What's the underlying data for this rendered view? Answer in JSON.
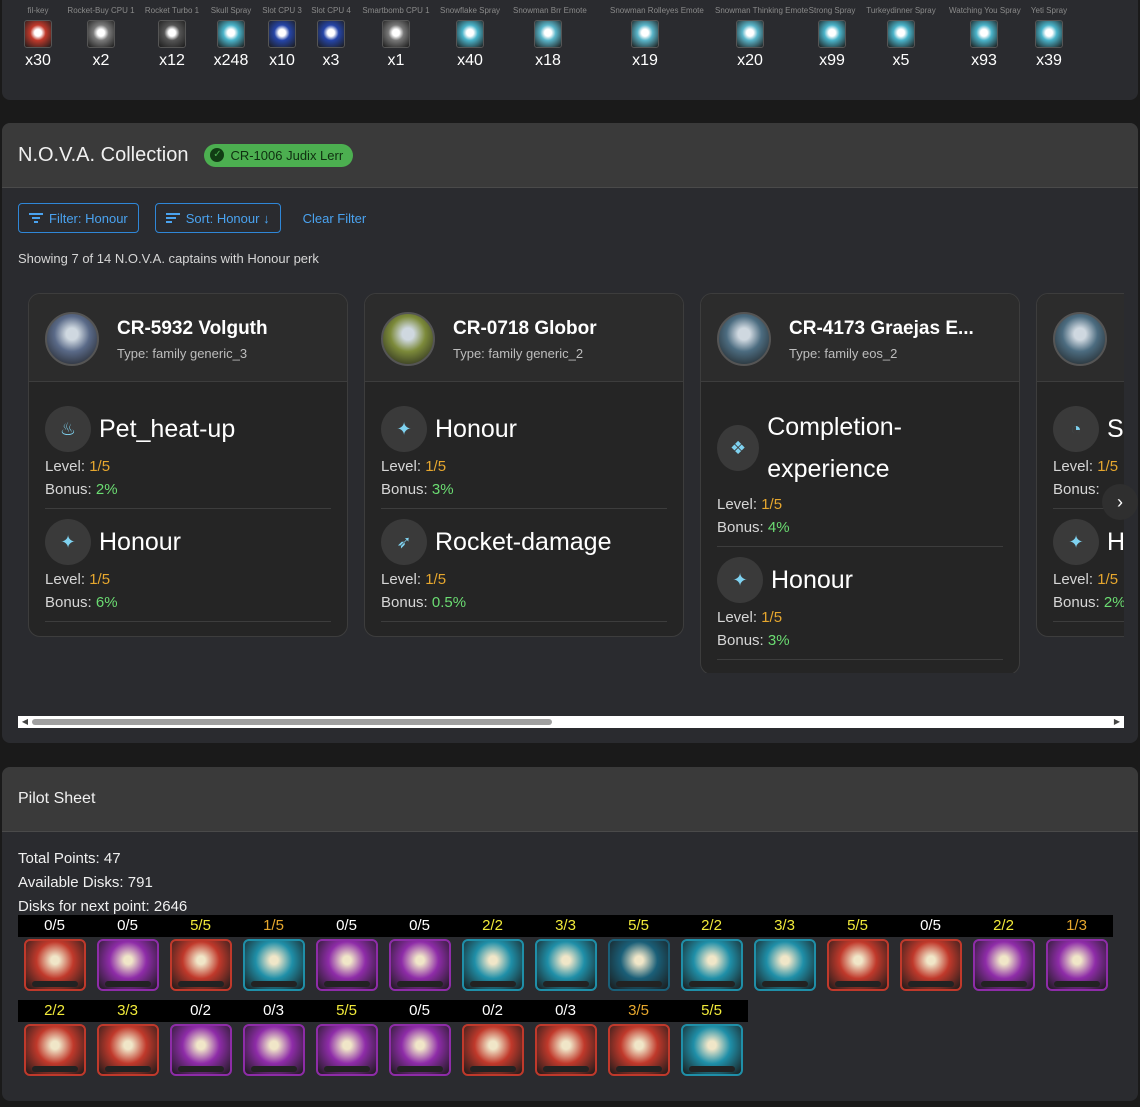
{
  "inventory": [
    {
      "name": "fil-key",
      "qty": "x30",
      "icon": "fil-key-icon",
      "color": "#c0392b"
    },
    {
      "name": "Rocket-Buy CPU 1",
      "qty": "x2",
      "icon": "cpu-icon",
      "color": "#7a7a7a"
    },
    {
      "name": "Rocket Turbo 1",
      "qty": "x12",
      "icon": "turbo-icon",
      "color": "#555555"
    },
    {
      "name": "Skull Spray",
      "qty": "x248",
      "icon": "skull-spray-icon",
      "color": "#4ab3c9"
    },
    {
      "name": "Slot CPU 3",
      "qty": "x10",
      "icon": "slot-cpu-icon",
      "color": "#2545a8"
    },
    {
      "name": "Slot CPU 4",
      "qty": "x3",
      "icon": "slot-cpu-icon",
      "color": "#2545a8"
    },
    {
      "name": "Smartbomb CPU 1",
      "qty": "x1",
      "icon": "smartbomb-icon",
      "color": "#777777"
    },
    {
      "name": "Snowflake Spray",
      "qty": "x40",
      "icon": "snowflake-spray-icon",
      "color": "#4ab3c9"
    },
    {
      "name": "Snowman Brr Emote",
      "qty": "x18",
      "icon": "snowman-icon",
      "color": "#5ab5c9"
    },
    {
      "name": "Snowman Rolleyes Emote",
      "qty": "x19",
      "icon": "snowman-icon",
      "color": "#5ab5c9"
    },
    {
      "name": "Snowman Thinking Emote",
      "qty": "x20",
      "icon": "snowman-icon",
      "color": "#5ab5c9"
    },
    {
      "name": "Strong Spray",
      "qty": "x99",
      "icon": "strong-spray-icon",
      "color": "#4ab3c9"
    },
    {
      "name": "Turkeydinner Spray",
      "qty": "x5",
      "icon": "turkey-spray-icon",
      "color": "#4ab3c9"
    },
    {
      "name": "Watching You Spray",
      "qty": "x93",
      "icon": "eye-spray-icon",
      "color": "#4ab3c9"
    },
    {
      "name": "Yeti Spray",
      "qty": "x39",
      "icon": "yeti-spray-icon",
      "color": "#4ab3c9"
    }
  ],
  "nova": {
    "title": "N.O.V.A. Collection",
    "badge": "CR-1006 Judix Lerr",
    "filter_label": "Filter: Honour",
    "sort_label": "Sort: Honour ↓",
    "clear_label": "Clear Filter",
    "showing": "Showing 7 of 14 N.O.V.A. captains with Honour perk",
    "cards": [
      {
        "name": "CR-5932 Volguth",
        "type": "Type: family generic_3",
        "perks": [
          {
            "name": "Pet_heat-up",
            "level": "1/5",
            "bonus": "2%",
            "icon": "pet-heat-icon"
          },
          {
            "name": "Honour",
            "level": "1/5",
            "bonus": "6%",
            "icon": "honour-icon"
          }
        ]
      },
      {
        "name": "CR-0718 Globor",
        "type": "Type: family generic_2",
        "perks": [
          {
            "name": "Honour",
            "level": "1/5",
            "bonus": "3%",
            "icon": "honour-icon"
          },
          {
            "name": "Rocket-damage",
            "level": "1/5",
            "bonus": "0.5%",
            "icon": "rocket-icon"
          }
        ]
      },
      {
        "name": "CR-4173 Graejas E...",
        "type": "Type: family eos_2",
        "perks": [
          {
            "name": "Completion-experience",
            "level": "1/5",
            "bonus": "4%",
            "icon": "completion-icon"
          },
          {
            "name": "Honour",
            "level": "1/5",
            "bonus": "3%",
            "icon": "honour-icon"
          }
        ]
      },
      {
        "name": "",
        "type": "",
        "perks": [
          {
            "name": "S",
            "level": "1/5",
            "bonus": "",
            "icon": "speed-icon"
          },
          {
            "name": "H",
            "level": "1/5",
            "bonus": "2%",
            "icon": "honour-icon"
          }
        ]
      }
    ],
    "labels": {
      "level": "Level: ",
      "bonus": "Bonus: "
    }
  },
  "pilot": {
    "title": "Pilot Sheet",
    "total_points": "Total Points: 47",
    "available_disks": "Available Disks: 791",
    "disks_next": "Disks for next point: 2646",
    "row1": [
      {
        "v": "0/5",
        "c": "white",
        "col": "#c0392b"
      },
      {
        "v": "0/5",
        "c": "white",
        "col": "#8e2ca8"
      },
      {
        "v": "5/5",
        "c": "yellow",
        "col": "#c0392b"
      },
      {
        "v": "1/5",
        "c": "gold",
        "col": "#1f8fa8"
      },
      {
        "v": "0/5",
        "c": "white",
        "col": "#8e2ca8"
      },
      {
        "v": "0/5",
        "c": "white",
        "col": "#8e2ca8"
      },
      {
        "v": "2/2",
        "c": "yellow",
        "col": "#1f8fa8"
      },
      {
        "v": "3/3",
        "c": "yellow",
        "col": "#1f8fa8"
      },
      {
        "v": "5/5",
        "c": "yellow",
        "col": "#1a5f78"
      },
      {
        "v": "2/2",
        "c": "yellow",
        "col": "#1f8fa8"
      },
      {
        "v": "3/3",
        "c": "yellow",
        "col": "#1f8fa8"
      },
      {
        "v": "5/5",
        "c": "yellow",
        "col": "#c0392b"
      },
      {
        "v": "0/5",
        "c": "white",
        "col": "#c0392b"
      },
      {
        "v": "2/2",
        "c": "yellow",
        "col": "#8e2ca8"
      },
      {
        "v": "1/3",
        "c": "gold",
        "col": "#8e2ca8"
      }
    ],
    "row2": [
      {
        "v": "2/2",
        "c": "yellow",
        "col": "#c0392b"
      },
      {
        "v": "3/3",
        "c": "yellow",
        "col": "#c0392b"
      },
      {
        "v": "0/2",
        "c": "white",
        "col": "#8e2ca8"
      },
      {
        "v": "0/3",
        "c": "white",
        "col": "#8e2ca8"
      },
      {
        "v": "5/5",
        "c": "yellow",
        "col": "#8e2ca8"
      },
      {
        "v": "0/5",
        "c": "white",
        "col": "#8e2ca8"
      },
      {
        "v": "0/2",
        "c": "white",
        "col": "#c0392b"
      },
      {
        "v": "0/3",
        "c": "white",
        "col": "#c0392b"
      },
      {
        "v": "3/5",
        "c": "gold",
        "col": "#c0392b"
      },
      {
        "v": "5/5",
        "c": "yellow",
        "col": "#1f8fa8"
      }
    ]
  }
}
